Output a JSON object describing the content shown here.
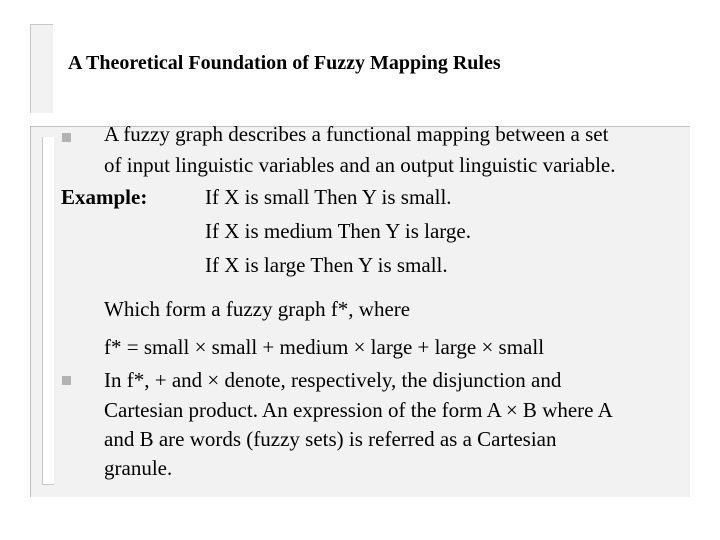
{
  "slide": {
    "title": "A Theoretical Foundation of Fuzzy Mapping Rules",
    "bullet1": {
      "lines": [
        "A fuzzy graph describes a functional mapping between a set",
        "of input linguistic variables and an output linguistic variable."
      ]
    },
    "example": {
      "label": "Example:",
      "rules": [
        "If X is small Then Y is small.",
        "If X is medium Then Y is large.",
        "If X is large Then Y is small."
      ]
    },
    "graph_intro": "Which form a fuzzy graph f*, where",
    "graph_formula": "f* = small × small + medium × large + large × small",
    "bullet2": {
      "lines": [
        "In f*, + and × denote, respectively, the disjunction and",
        "Cartesian product. An expression of the form A × B where A",
        "and B are words (fuzzy sets) is referred as a Cartesian",
        "granule."
      ]
    },
    "colors": {
      "panel_background": "#f2f2f2",
      "bullet": "#b3b3b3"
    }
  }
}
